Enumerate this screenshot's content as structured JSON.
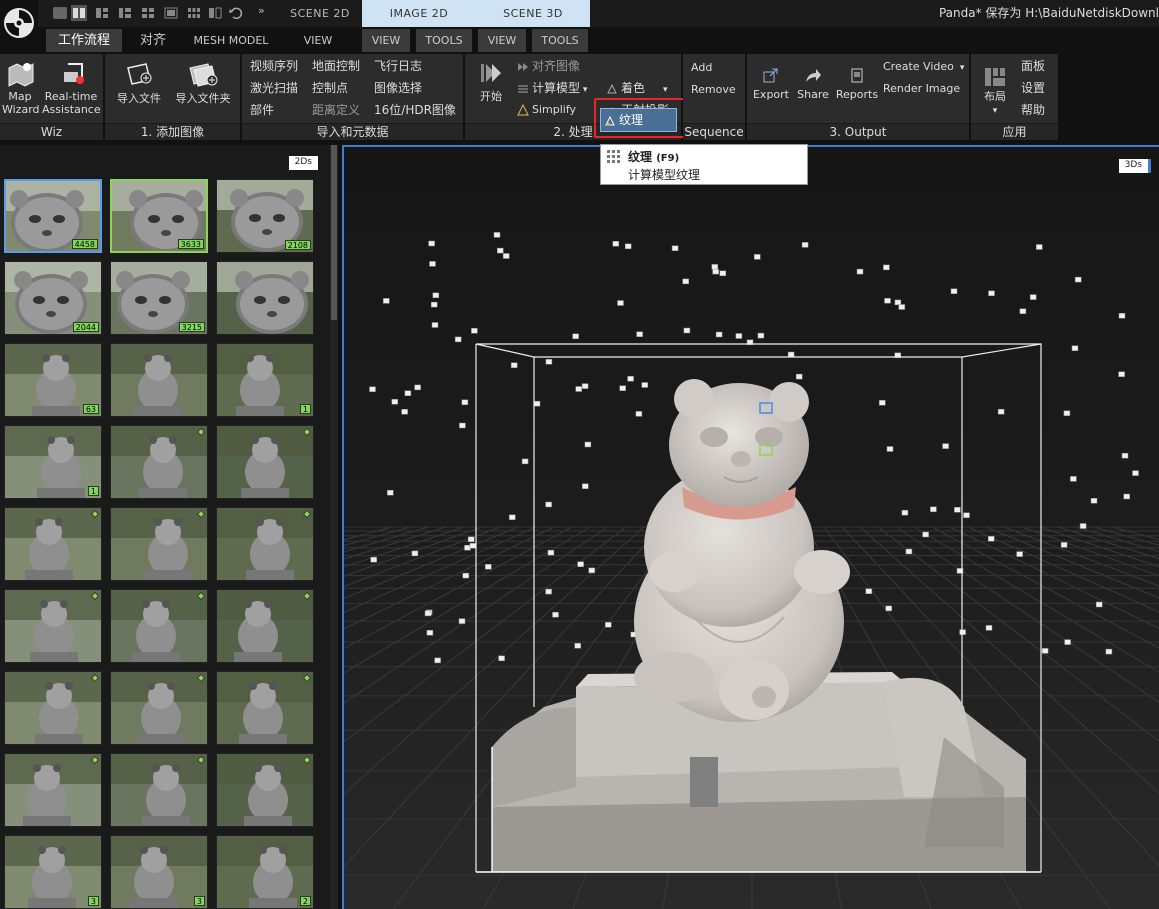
{
  "window": {
    "title": "Panda* 保存为 H:\\BaiduNetdiskDownl",
    "scene_tabs": [
      "SCENE 2D",
      "IMAGE 2D",
      "SCENE 3D"
    ],
    "more_chevron": "»"
  },
  "menu": {
    "workflow": "工作流程",
    "align": "对齐",
    "mesh_model": "MESH MODEL",
    "view1": "VIEW",
    "view2": "VIEW",
    "tools1": "TOOLS",
    "view3": "VIEW",
    "tools2": "TOOLS"
  },
  "ribbon": {
    "wiz": {
      "label": "Wiz",
      "map_wizard": [
        "Map",
        "Wizard"
      ],
      "realtime": [
        "Real-time",
        "Assistance"
      ]
    },
    "add_images": {
      "label": "1. 添加图像",
      "import_files": "导入文件",
      "import_folder": "导入文件夹"
    },
    "import_meta": {
      "label": "导入和元数据",
      "col1": [
        "视频序列",
        "激光扫描",
        "部件"
      ],
      "col2": [
        "地面控制",
        "控制点",
        "距离定义"
      ],
      "col3": [
        "飞行日志",
        "图像选择",
        "16位/HDR图像"
      ]
    },
    "process": {
      "label": "2. 处理",
      "start": "开始",
      "align_images": "对齐图像",
      "compute_model": "计算模型",
      "simplify": "Simplify",
      "texture": "纹理",
      "colorize": "着色",
      "ortho": "正射投影"
    },
    "sequence": {
      "label": "Sequence",
      "add": "Add",
      "remove": "Remove"
    },
    "output": {
      "label": "3. Output",
      "export": "Export",
      "share": "Share",
      "reports": "Reports",
      "create_video": "Create Video",
      "render_image": "Render Image"
    },
    "app": {
      "label": "应用",
      "layout": "布局",
      "panel": "面板",
      "settings": "设置",
      "help": "帮助"
    }
  },
  "tooltip": {
    "title": "纹理",
    "shortcut": "(F9)",
    "description": "计算模型纹理"
  },
  "left_panel": {
    "badge": "2Ds",
    "thumbnails": [
      {
        "count": "4458",
        "selection": "blue"
      },
      {
        "count": "3633",
        "selection": "green"
      },
      {
        "count": "2108"
      },
      {
        "count": "2044"
      },
      {
        "count": "3215"
      },
      {
        "count": ""
      },
      {
        "count": "63"
      },
      {
        "count": ""
      },
      {
        "count": "1"
      },
      {
        "count": "1"
      },
      {
        "count": ""
      },
      {
        "count": ""
      },
      {
        "count": ""
      },
      {
        "count": ""
      },
      {
        "count": ""
      },
      {
        "count": ""
      },
      {
        "count": ""
      },
      {
        "count": ""
      },
      {
        "count": ""
      },
      {
        "count": ""
      },
      {
        "count": ""
      },
      {
        "count": ""
      },
      {
        "count": ""
      },
      {
        "count": ""
      },
      {
        "count": "3"
      },
      {
        "count": "3"
      },
      {
        "count": "2"
      }
    ]
  },
  "viewport": {
    "badge": "3Ds"
  },
  "colors": {
    "accent_blue": "#3a7fd0",
    "highlight_red": "#e8262a",
    "count_green": "#7ed957",
    "tab_light_blue": "#cfe3f4"
  }
}
